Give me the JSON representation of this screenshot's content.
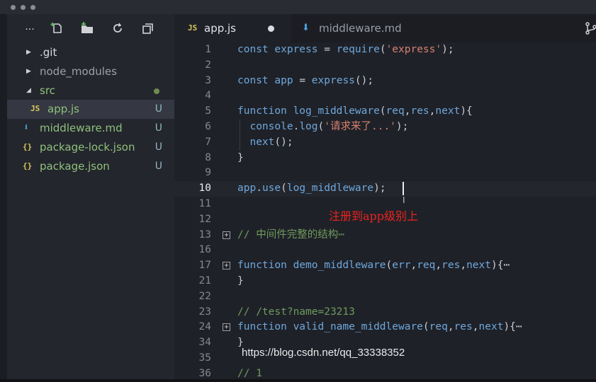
{
  "sidebar": {
    "toolbar": {
      "more": "...",
      "new_file_icon": "new-file-icon",
      "new_folder_icon": "new-folder-icon",
      "refresh_icon": "refresh-icon",
      "collapse_icon": "collapse-all-icon"
    },
    "tree": [
      {
        "label": ".git",
        "type": "folder",
        "expanded": false,
        "status": ""
      },
      {
        "label": "node_modules",
        "type": "folder",
        "expanded": false,
        "status": ""
      },
      {
        "label": "src",
        "type": "folder",
        "expanded": true,
        "status": "dot"
      },
      {
        "label": "app.js",
        "type": "js",
        "status": "U"
      },
      {
        "label": "middleware.md",
        "type": "md",
        "status": "U"
      },
      {
        "label": "package-lock.json",
        "type": "json",
        "status": "U"
      },
      {
        "label": "package.json",
        "type": "json",
        "status": "U"
      }
    ]
  },
  "tabs": [
    {
      "label": "app.js",
      "icon": "JS",
      "modified": true,
      "active": true
    },
    {
      "label": "middleware.md",
      "icon": "markdown-icon",
      "modified": false,
      "active": false
    }
  ],
  "code": {
    "line_numbers": [
      "1",
      "2",
      "3",
      "4",
      "5",
      "6",
      "7",
      "8",
      "9",
      "10",
      "11",
      "12",
      "13",
      "16",
      "17",
      "21",
      "22",
      "23",
      "24",
      "34",
      "35",
      "36"
    ],
    "lines": [
      {
        "t": "const express = require('express');"
      },
      {
        "t": ""
      },
      {
        "t": "const app = express();"
      },
      {
        "t": ""
      },
      {
        "t": "function log_middleware(req,res,next){"
      },
      {
        "t": "  console.log('请求来了...');"
      },
      {
        "t": "  next();"
      },
      {
        "t": "}"
      },
      {
        "t": ""
      },
      {
        "t": "app.use(log_middleware);"
      },
      {
        "t": ""
      },
      {
        "t": ""
      },
      {
        "t": "// 中间件完整的结构⋯",
        "fold": true
      },
      {
        "t": ""
      },
      {
        "t": "function demo_middleware(err,req,res,next){⋯",
        "fold": true
      },
      {
        "t": "}"
      },
      {
        "t": ""
      },
      {
        "t": "// /test?name=23213"
      },
      {
        "t": "function valid_name_middleware(req,res,next){⋯",
        "fold": true
      },
      {
        "t": "}"
      },
      {
        "t": ""
      },
      {
        "t": "// 1"
      }
    ]
  },
  "annotation": "注册到app级别上",
  "watermark": "https://blog.csdn.net/qq_33338352",
  "colors": {
    "keyword": "#6ea8dc",
    "string": "#d68270",
    "comment": "#6f9b5c",
    "annotation": "#e8241f",
    "js_badge": "#d8c75a",
    "md_icon": "#4a9fd6"
  }
}
